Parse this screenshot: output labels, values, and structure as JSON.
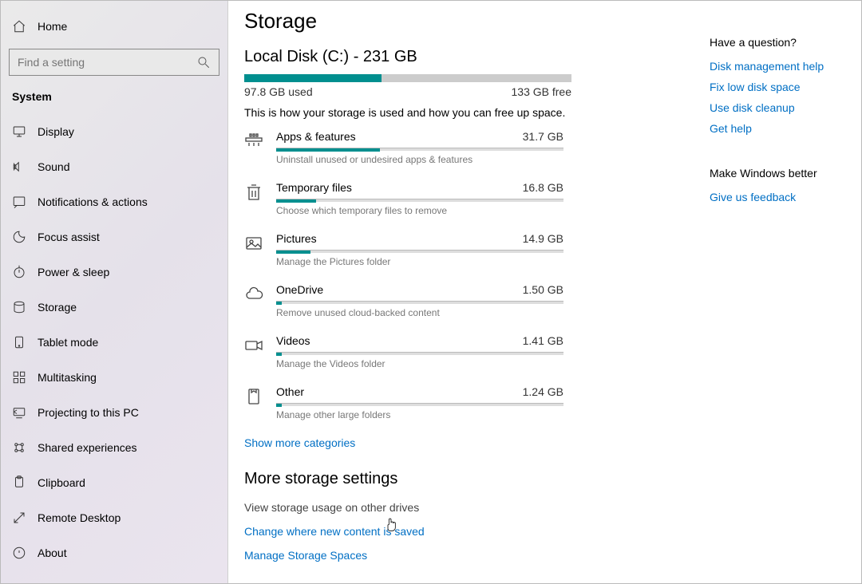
{
  "accent": "#008f8f",
  "link_color": "#006fc4",
  "sidebar": {
    "home": "Home",
    "search_placeholder": "Find a setting",
    "section": "System",
    "items": [
      {
        "label": "Display"
      },
      {
        "label": "Sound"
      },
      {
        "label": "Notifications & actions"
      },
      {
        "label": "Focus assist"
      },
      {
        "label": "Power & sleep"
      },
      {
        "label": "Storage"
      },
      {
        "label": "Tablet mode"
      },
      {
        "label": "Multitasking"
      },
      {
        "label": "Projecting to this PC"
      },
      {
        "label": "Shared experiences"
      },
      {
        "label": "Clipboard"
      },
      {
        "label": "Remote Desktop"
      },
      {
        "label": "About"
      }
    ]
  },
  "page": {
    "title": "Storage",
    "disk_title": "Local Disk (C:) - 231 GB",
    "used_label": "97.8 GB used",
    "free_label": "133 GB free",
    "used_pct": 42,
    "description": "This is how your storage is used and how you can free up space.",
    "show_more": "Show more categories"
  },
  "categories": [
    {
      "name": "Apps & features",
      "size": "31.7 GB",
      "pct": 36,
      "hint": "Uninstall unused or undesired apps & features"
    },
    {
      "name": "Temporary files",
      "size": "16.8 GB",
      "pct": 14,
      "hint": "Choose which temporary files to remove"
    },
    {
      "name": "Pictures",
      "size": "14.9 GB",
      "pct": 12,
      "hint": "Manage the Pictures folder"
    },
    {
      "name": "OneDrive",
      "size": "1.50 GB",
      "pct": 2,
      "hint": "Remove unused cloud-backed content"
    },
    {
      "name": "Videos",
      "size": "1.41 GB",
      "pct": 2,
      "hint": "Manage the Videos folder"
    },
    {
      "name": "Other",
      "size": "1.24 GB",
      "pct": 2,
      "hint": "Manage other large folders"
    }
  ],
  "more_section": {
    "title": "More storage settings",
    "links": [
      {
        "label": "View storage usage on other drives",
        "muted": true
      },
      {
        "label": "Change where new content is saved"
      },
      {
        "label": "Manage Storage Spaces"
      }
    ]
  },
  "help": {
    "question": "Have a question?",
    "links": [
      "Disk management help",
      "Fix low disk space",
      "Use disk cleanup",
      "Get help"
    ],
    "better_title": "Make Windows better",
    "feedback": "Give us feedback"
  }
}
